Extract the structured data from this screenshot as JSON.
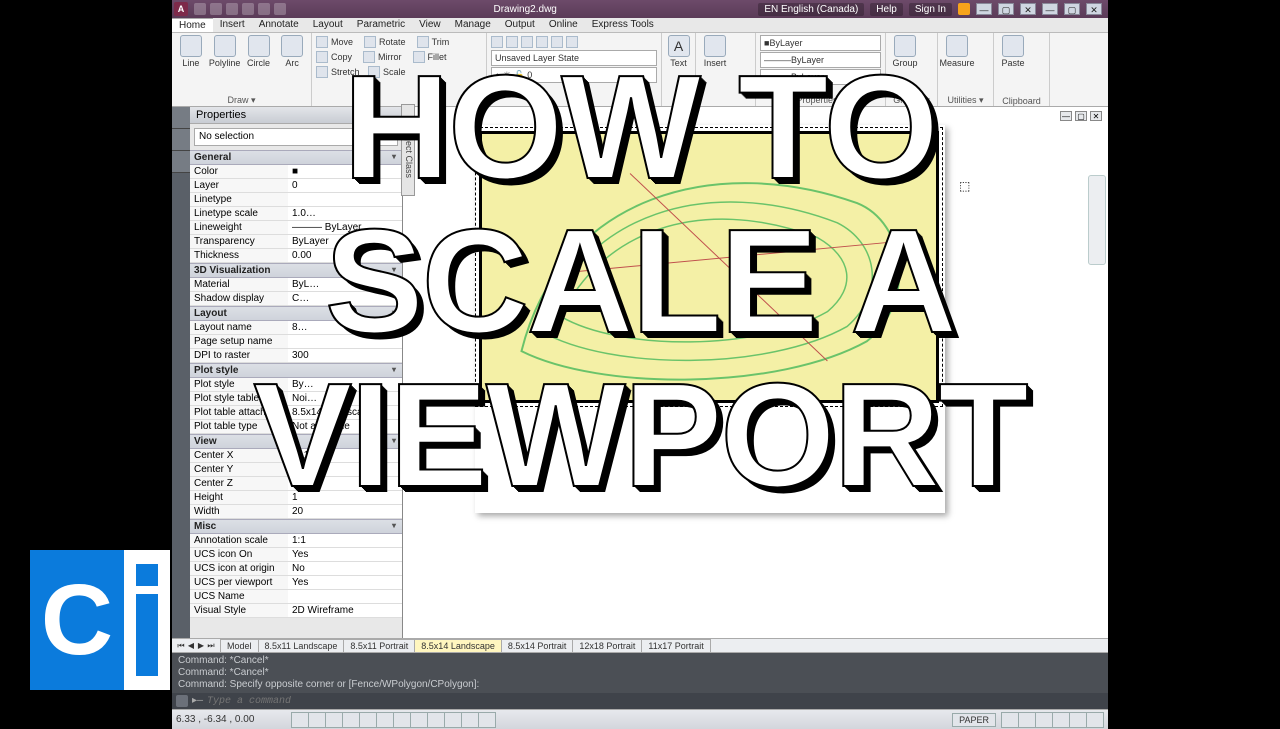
{
  "title": {
    "doc": "Drawing2.dwg",
    "lang": "EN English (Canada)",
    "help": "Help",
    "sign": "Sign In"
  },
  "menu": [
    "Home",
    "Insert",
    "Annotate",
    "Layout",
    "Parametric",
    "View",
    "Manage",
    "Output",
    "Online",
    "Express Tools"
  ],
  "ribbon": {
    "draw": {
      "label": "Draw ▾",
      "line": "Line",
      "poly": "Polyline",
      "circle": "Circle",
      "arc": "Arc"
    },
    "modify": {
      "move": "Move",
      "rotate": "Rotate",
      "trim": "Trim",
      "copy": "Copy",
      "mirror": "Mirror",
      "fillet": "Fillet",
      "stretch": "Stretch",
      "scale": "Scale"
    },
    "layers": {
      "state": "Unsaved Layer State",
      "by": "ByLayer"
    },
    "annot": {
      "text": "Text"
    },
    "block": {
      "insert": "Insert"
    },
    "props": {
      "label": "Properties ▾",
      "by": "ByLayer"
    },
    "groups": {
      "label": "Groups ▾",
      "group": "Group"
    },
    "utils": {
      "label": "Utilities ▾",
      "measure": "Measure"
    },
    "clip": {
      "label": "Clipboard",
      "paste": "Paste"
    }
  },
  "props": {
    "title": "Properties",
    "sel": "No selection",
    "groups": [
      {
        "name": "General",
        "rows": [
          [
            "Color",
            "■"
          ],
          [
            "Layer",
            "0"
          ],
          [
            "Linetype",
            ""
          ],
          [
            "Linetype scale",
            "1.0…"
          ],
          [
            "Lineweight",
            "——— ByLayer"
          ],
          [
            "Transparency",
            "ByLayer"
          ],
          [
            "Thickness",
            "0.00"
          ]
        ]
      },
      {
        "name": "3D Visualization",
        "rows": [
          [
            "Material",
            "ByL…"
          ],
          [
            "Shadow display",
            "C…"
          ]
        ]
      },
      {
        "name": "Layout",
        "rows": [
          [
            "Layout name",
            "8…"
          ],
          [
            "Page setup name",
            "<No…"
          ],
          [
            "DPI to raster",
            "300"
          ]
        ]
      },
      {
        "name": "Plot style",
        "rows": [
          [
            "Plot style",
            "By…"
          ],
          [
            "Plot style table",
            "Noi…"
          ],
          [
            "Plot table attach…",
            "8.5x14 Landscape"
          ],
          [
            "Plot table type",
            "Not available"
          ]
        ]
      },
      {
        "name": "View",
        "rows": [
          [
            "Center X",
            "-1.18"
          ],
          [
            "Center Y",
            "-4.…"
          ],
          [
            "Center Z",
            ""
          ],
          [
            "Height",
            "1"
          ],
          [
            "Width",
            "20"
          ]
        ]
      },
      {
        "name": "Misc",
        "rows": [
          [
            "Annotation scale",
            "1:1"
          ],
          [
            "UCS icon On",
            "Yes"
          ],
          [
            "UCS icon at origin",
            "No"
          ],
          [
            "UCS per viewport",
            "Yes"
          ],
          [
            "UCS Name",
            ""
          ],
          [
            "Visual Style",
            "2D Wireframe"
          ]
        ]
      }
    ]
  },
  "objtab": "Object Class",
  "layout_tabs": [
    "Model",
    "8.5x11 Landscape",
    "8.5x11 Portrait",
    "8.5x14 Landscape",
    "8.5x14 Portrait",
    "12x18 Portrait",
    "11x17 Portrait"
  ],
  "layout_active": 3,
  "cmd": {
    "h1": "Command: *Cancel*",
    "h2": "Command: *Cancel*",
    "h3": "Command: Specify opposite corner or [Fence/WPolygon/CPolygon]:",
    "ph": "Type a command"
  },
  "status": {
    "coords": "6.33 , -6.34 , 0.00",
    "paper": "PAPER"
  },
  "overlay": {
    "l1": "HOW TO",
    "l2": "SCALE A",
    "l3": "VIEWPORT"
  },
  "logo": "C"
}
